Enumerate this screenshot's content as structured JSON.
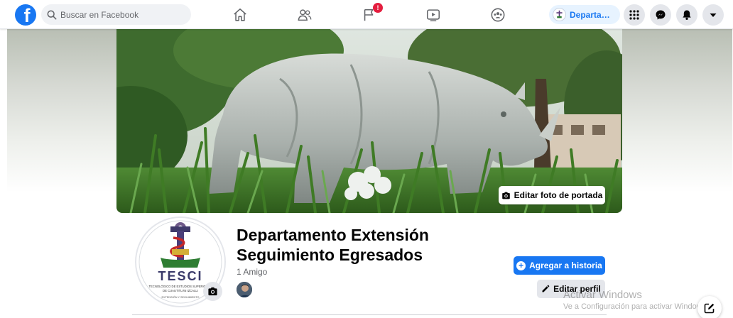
{
  "search": {
    "placeholder": "Buscar en Facebook"
  },
  "nav": {
    "tabs": [
      {
        "name": "home",
        "icon": "home-icon"
      },
      {
        "name": "friends",
        "icon": "friends-icon"
      },
      {
        "name": "pages",
        "icon": "flag-icon",
        "badge": "!"
      },
      {
        "name": "watch",
        "icon": "video-icon"
      },
      {
        "name": "groups",
        "icon": "groups-icon"
      }
    ],
    "profile_chip": "Departam..."
  },
  "cover": {
    "edit_label": "Editar foto de portada"
  },
  "profile": {
    "name_line1": "Departamento Extensión",
    "name_line2": "Seguimiento Egresados",
    "friends": "1 Amigo",
    "logo_text": "TESCI",
    "logo_subtext": "TECNOLÓGICO DE ESTUDIOS SUPERIORES DE CUAUTITLÁN IZCALLI",
    "logo_bottom": "EXTENSIÓN Y SEGUIMIENTO"
  },
  "actions": {
    "add_story": "Agregar a historia",
    "edit_profile": "Editar perfil"
  },
  "watermark": {
    "title": "Activar Windows",
    "subtitle": "Ve a Configuración para activar Windows."
  },
  "colors": {
    "brand": "#1877f2",
    "badge": "#e41e3f",
    "button_gray": "#e4e6eb"
  }
}
